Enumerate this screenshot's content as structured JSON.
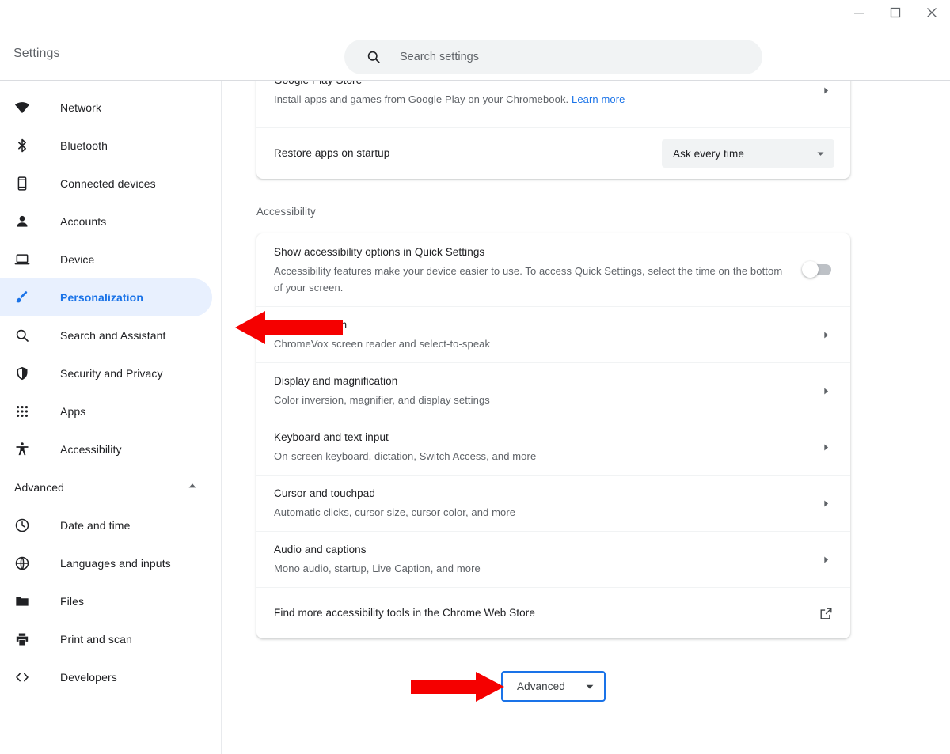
{
  "window": {
    "controls": [
      {
        "name": "minimize-button",
        "label": "Minimize"
      },
      {
        "name": "maximize-button",
        "label": "Maximize"
      },
      {
        "name": "close-button",
        "label": "Close"
      }
    ]
  },
  "header": {
    "title": "Settings",
    "search": {
      "placeholder": "Search settings",
      "value": "",
      "icon": "search-icon"
    }
  },
  "sidebar": {
    "items": [
      {
        "label": "Network",
        "icon": "wifi-icon",
        "selected": false
      },
      {
        "label": "Bluetooth",
        "icon": "bluetooth-icon",
        "selected": false
      },
      {
        "label": "Connected devices",
        "icon": "phone-icon",
        "selected": false
      },
      {
        "label": "Accounts",
        "icon": "person-icon",
        "selected": false
      },
      {
        "label": "Device",
        "icon": "laptop-icon",
        "selected": false
      },
      {
        "label": "Personalization",
        "icon": "brush-icon",
        "selected": true
      },
      {
        "label": "Search and Assistant",
        "icon": "search-icon",
        "selected": false
      },
      {
        "label": "Security and Privacy",
        "icon": "shield-icon",
        "selected": false
      },
      {
        "label": "Apps",
        "icon": "grid-apps-icon",
        "selected": false
      },
      {
        "label": "Accessibility",
        "icon": "accessibility-icon",
        "selected": false
      }
    ],
    "advanced_group": {
      "label": "Advanced",
      "expanded": true,
      "icon": "chevron-up-icon",
      "items": [
        {
          "label": "Date and time",
          "icon": "clock-icon"
        },
        {
          "label": "Languages and inputs",
          "icon": "globe-icon"
        },
        {
          "label": "Files",
          "icon": "folder-icon"
        },
        {
          "label": "Print and scan",
          "icon": "printer-icon"
        },
        {
          "label": "Developers",
          "icon": "code-brackets-icon"
        }
      ]
    }
  },
  "main": {
    "top_card": {
      "rows": [
        {
          "name": "google-play-store-row",
          "title": "Google Play Store",
          "subtitle": "Install apps and games from Google Play on your Chromebook.",
          "link_text": "Learn more",
          "control": "chevron-right-icon"
        },
        {
          "name": "restore-apps-on-startup-row",
          "title": "Restore apps on startup",
          "subtitle": "",
          "control": "dropdown",
          "dropdown_value": "Ask every time",
          "dropdown_icon": "chevron-down-icon"
        }
      ]
    },
    "accessibility_section_title": "Accessibility",
    "accessibility_card": {
      "rows": [
        {
          "name": "show-accessibility-options-row",
          "title": "Show accessibility options in Quick Settings",
          "subtitle": "Accessibility features make your device easier to use. To access Quick Settings, select the time on the bottom of your screen.",
          "control": "toggle",
          "toggle_on": false
        },
        {
          "name": "text-to-speech-row",
          "title": "Text-to-Speech",
          "title_visible_fragment": "ech",
          "subtitle": "ChromeVox screen reader and select-to-speak",
          "control": "chevron-right-icon"
        },
        {
          "name": "display-and-magnification-row",
          "title": "Display and magnification",
          "subtitle": "Color inversion, magnifier, and display settings",
          "control": "chevron-right-icon"
        },
        {
          "name": "keyboard-and-text-input-row",
          "title": "Keyboard and text input",
          "subtitle": "On-screen keyboard, dictation, Switch Access, and more",
          "control": "chevron-right-icon"
        },
        {
          "name": "cursor-and-touchpad-row",
          "title": "Cursor and touchpad",
          "subtitle": "Automatic clicks, cursor size, cursor color, and more",
          "control": "chevron-right-icon"
        },
        {
          "name": "audio-and-captions-row",
          "title": "Audio and captions",
          "subtitle": "Mono audio, startup, Live Caption, and more",
          "control": "chevron-right-icon"
        },
        {
          "name": "chrome-web-store-row",
          "title": "Find more accessibility tools in the Chrome Web Store",
          "subtitle": "",
          "control": "external-link-icon"
        }
      ]
    },
    "advanced_button": {
      "label": "Advanced",
      "icon": "chevron-down-icon",
      "focused": true
    }
  },
  "annotations": {
    "arrow_color": "#f50000",
    "arrows": [
      {
        "name": "annotation-arrow-text-to-speech",
        "direction": "left",
        "target": "text-to-speech-row"
      },
      {
        "name": "annotation-arrow-advanced",
        "direction": "right",
        "target": "advanced-button"
      }
    ]
  },
  "colors": {
    "accent": "#1a73e8",
    "selected_nav_bg": "#e8f0fe",
    "search_bg": "#f1f3f4",
    "text_primary": "#202124",
    "text_secondary": "#5f6368",
    "card_bg": "#ffffff",
    "page_bg": "#ffffff"
  }
}
